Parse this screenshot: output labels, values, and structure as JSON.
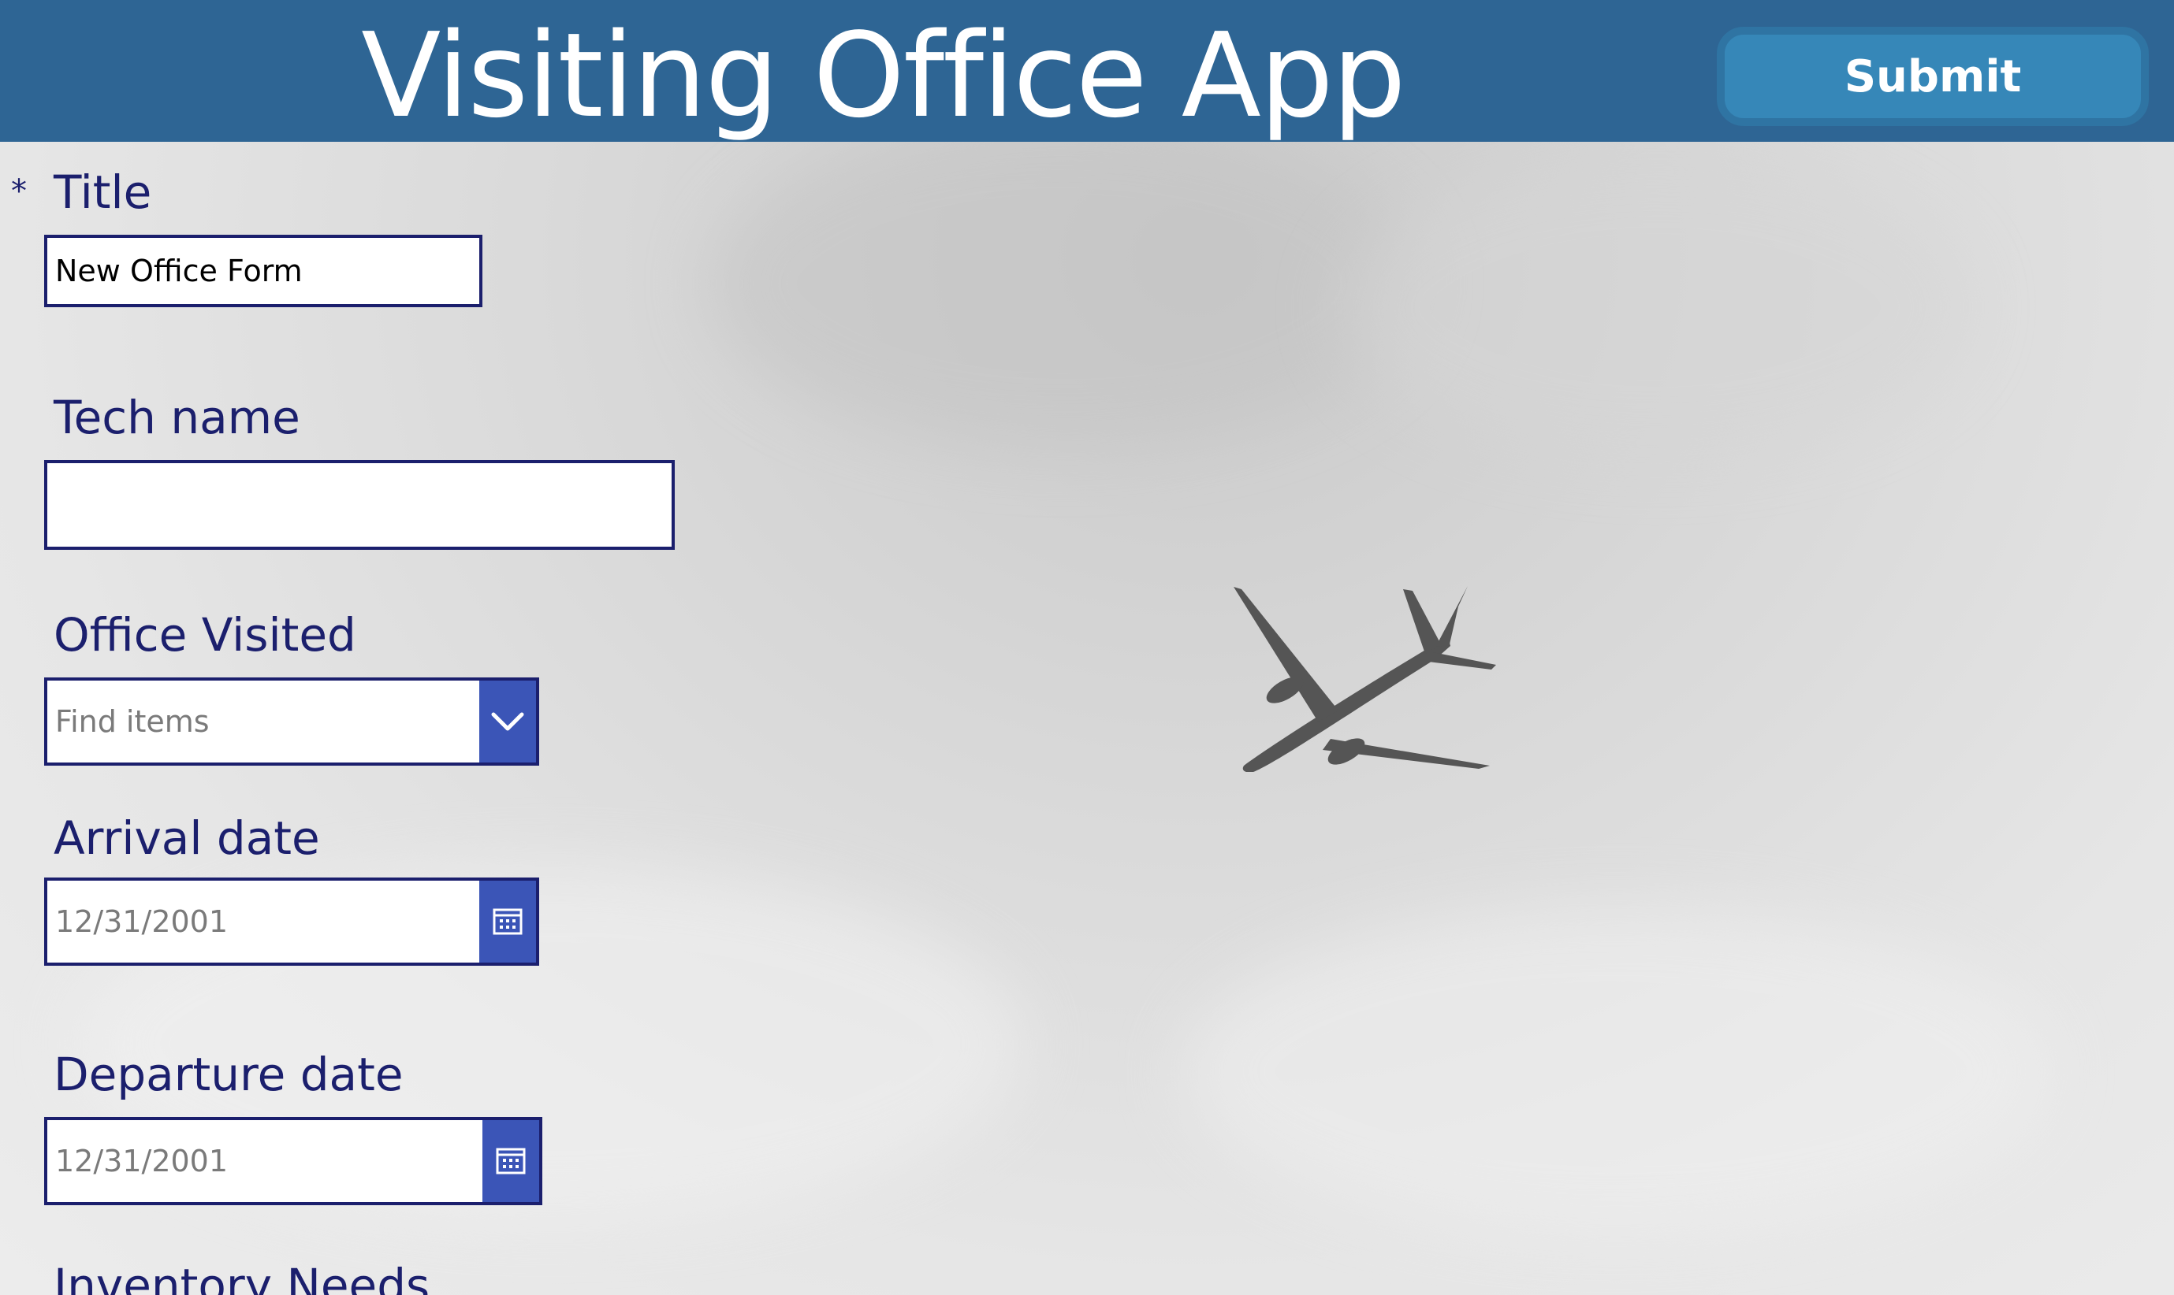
{
  "header": {
    "title": "Visiting Office App",
    "submit_label": "Submit"
  },
  "form": {
    "required_marker": "*",
    "title": {
      "label": "Title",
      "value": "New Office Form"
    },
    "tech_name": {
      "label": "Tech name",
      "value": ""
    },
    "office_visited": {
      "label": "Office Visited",
      "placeholder": "Find items",
      "icon": "chevron-down-icon"
    },
    "arrival_date": {
      "label": "Arrival date",
      "value": "12/31/2001",
      "icon": "calendar-icon"
    },
    "departure_date": {
      "label": "Departure date",
      "value": "12/31/2001",
      "icon": "calendar-icon"
    },
    "inventory_needs": {
      "label": "Inventory Needs"
    }
  },
  "colors": {
    "header_bg": "#2e6594",
    "submit_bg": "#3687b8",
    "label_text": "#1b1f6d",
    "icon_button_bg": "#3b55b7"
  }
}
